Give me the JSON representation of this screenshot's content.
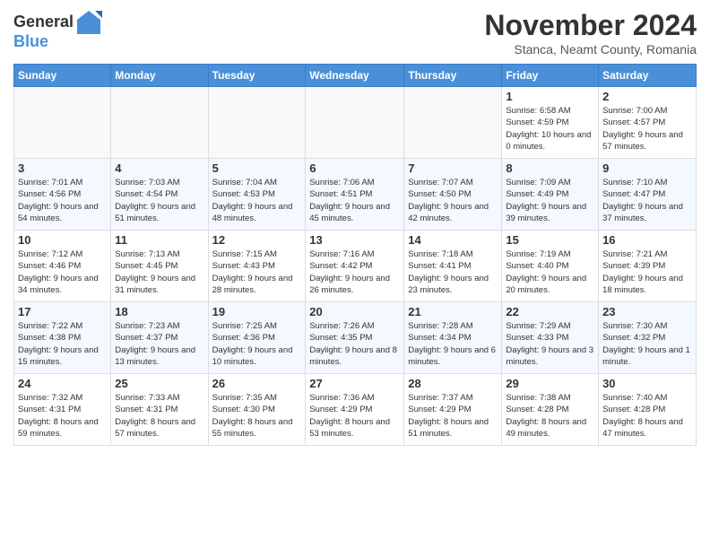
{
  "header": {
    "logo_line1": "General",
    "logo_line2": "Blue",
    "month": "November 2024",
    "location": "Stanca, Neamt County, Romania"
  },
  "weekdays": [
    "Sunday",
    "Monday",
    "Tuesday",
    "Wednesday",
    "Thursday",
    "Friday",
    "Saturday"
  ],
  "weeks": [
    [
      {
        "day": "",
        "info": ""
      },
      {
        "day": "",
        "info": ""
      },
      {
        "day": "",
        "info": ""
      },
      {
        "day": "",
        "info": ""
      },
      {
        "day": "",
        "info": ""
      },
      {
        "day": "1",
        "info": "Sunrise: 6:58 AM\nSunset: 4:59 PM\nDaylight: 10 hours and 0 minutes."
      },
      {
        "day": "2",
        "info": "Sunrise: 7:00 AM\nSunset: 4:57 PM\nDaylight: 9 hours and 57 minutes."
      }
    ],
    [
      {
        "day": "3",
        "info": "Sunrise: 7:01 AM\nSunset: 4:56 PM\nDaylight: 9 hours and 54 minutes."
      },
      {
        "day": "4",
        "info": "Sunrise: 7:03 AM\nSunset: 4:54 PM\nDaylight: 9 hours and 51 minutes."
      },
      {
        "day": "5",
        "info": "Sunrise: 7:04 AM\nSunset: 4:53 PM\nDaylight: 9 hours and 48 minutes."
      },
      {
        "day": "6",
        "info": "Sunrise: 7:06 AM\nSunset: 4:51 PM\nDaylight: 9 hours and 45 minutes."
      },
      {
        "day": "7",
        "info": "Sunrise: 7:07 AM\nSunset: 4:50 PM\nDaylight: 9 hours and 42 minutes."
      },
      {
        "day": "8",
        "info": "Sunrise: 7:09 AM\nSunset: 4:49 PM\nDaylight: 9 hours and 39 minutes."
      },
      {
        "day": "9",
        "info": "Sunrise: 7:10 AM\nSunset: 4:47 PM\nDaylight: 9 hours and 37 minutes."
      }
    ],
    [
      {
        "day": "10",
        "info": "Sunrise: 7:12 AM\nSunset: 4:46 PM\nDaylight: 9 hours and 34 minutes."
      },
      {
        "day": "11",
        "info": "Sunrise: 7:13 AM\nSunset: 4:45 PM\nDaylight: 9 hours and 31 minutes."
      },
      {
        "day": "12",
        "info": "Sunrise: 7:15 AM\nSunset: 4:43 PM\nDaylight: 9 hours and 28 minutes."
      },
      {
        "day": "13",
        "info": "Sunrise: 7:16 AM\nSunset: 4:42 PM\nDaylight: 9 hours and 26 minutes."
      },
      {
        "day": "14",
        "info": "Sunrise: 7:18 AM\nSunset: 4:41 PM\nDaylight: 9 hours and 23 minutes."
      },
      {
        "day": "15",
        "info": "Sunrise: 7:19 AM\nSunset: 4:40 PM\nDaylight: 9 hours and 20 minutes."
      },
      {
        "day": "16",
        "info": "Sunrise: 7:21 AM\nSunset: 4:39 PM\nDaylight: 9 hours and 18 minutes."
      }
    ],
    [
      {
        "day": "17",
        "info": "Sunrise: 7:22 AM\nSunset: 4:38 PM\nDaylight: 9 hours and 15 minutes."
      },
      {
        "day": "18",
        "info": "Sunrise: 7:23 AM\nSunset: 4:37 PM\nDaylight: 9 hours and 13 minutes."
      },
      {
        "day": "19",
        "info": "Sunrise: 7:25 AM\nSunset: 4:36 PM\nDaylight: 9 hours and 10 minutes."
      },
      {
        "day": "20",
        "info": "Sunrise: 7:26 AM\nSunset: 4:35 PM\nDaylight: 9 hours and 8 minutes."
      },
      {
        "day": "21",
        "info": "Sunrise: 7:28 AM\nSunset: 4:34 PM\nDaylight: 9 hours and 6 minutes."
      },
      {
        "day": "22",
        "info": "Sunrise: 7:29 AM\nSunset: 4:33 PM\nDaylight: 9 hours and 3 minutes."
      },
      {
        "day": "23",
        "info": "Sunrise: 7:30 AM\nSunset: 4:32 PM\nDaylight: 9 hours and 1 minute."
      }
    ],
    [
      {
        "day": "24",
        "info": "Sunrise: 7:32 AM\nSunset: 4:31 PM\nDaylight: 8 hours and 59 minutes."
      },
      {
        "day": "25",
        "info": "Sunrise: 7:33 AM\nSunset: 4:31 PM\nDaylight: 8 hours and 57 minutes."
      },
      {
        "day": "26",
        "info": "Sunrise: 7:35 AM\nSunset: 4:30 PM\nDaylight: 8 hours and 55 minutes."
      },
      {
        "day": "27",
        "info": "Sunrise: 7:36 AM\nSunset: 4:29 PM\nDaylight: 8 hours and 53 minutes."
      },
      {
        "day": "28",
        "info": "Sunrise: 7:37 AM\nSunset: 4:29 PM\nDaylight: 8 hours and 51 minutes."
      },
      {
        "day": "29",
        "info": "Sunrise: 7:38 AM\nSunset: 4:28 PM\nDaylight: 8 hours and 49 minutes."
      },
      {
        "day": "30",
        "info": "Sunrise: 7:40 AM\nSunset: 4:28 PM\nDaylight: 8 hours and 47 minutes."
      }
    ]
  ]
}
